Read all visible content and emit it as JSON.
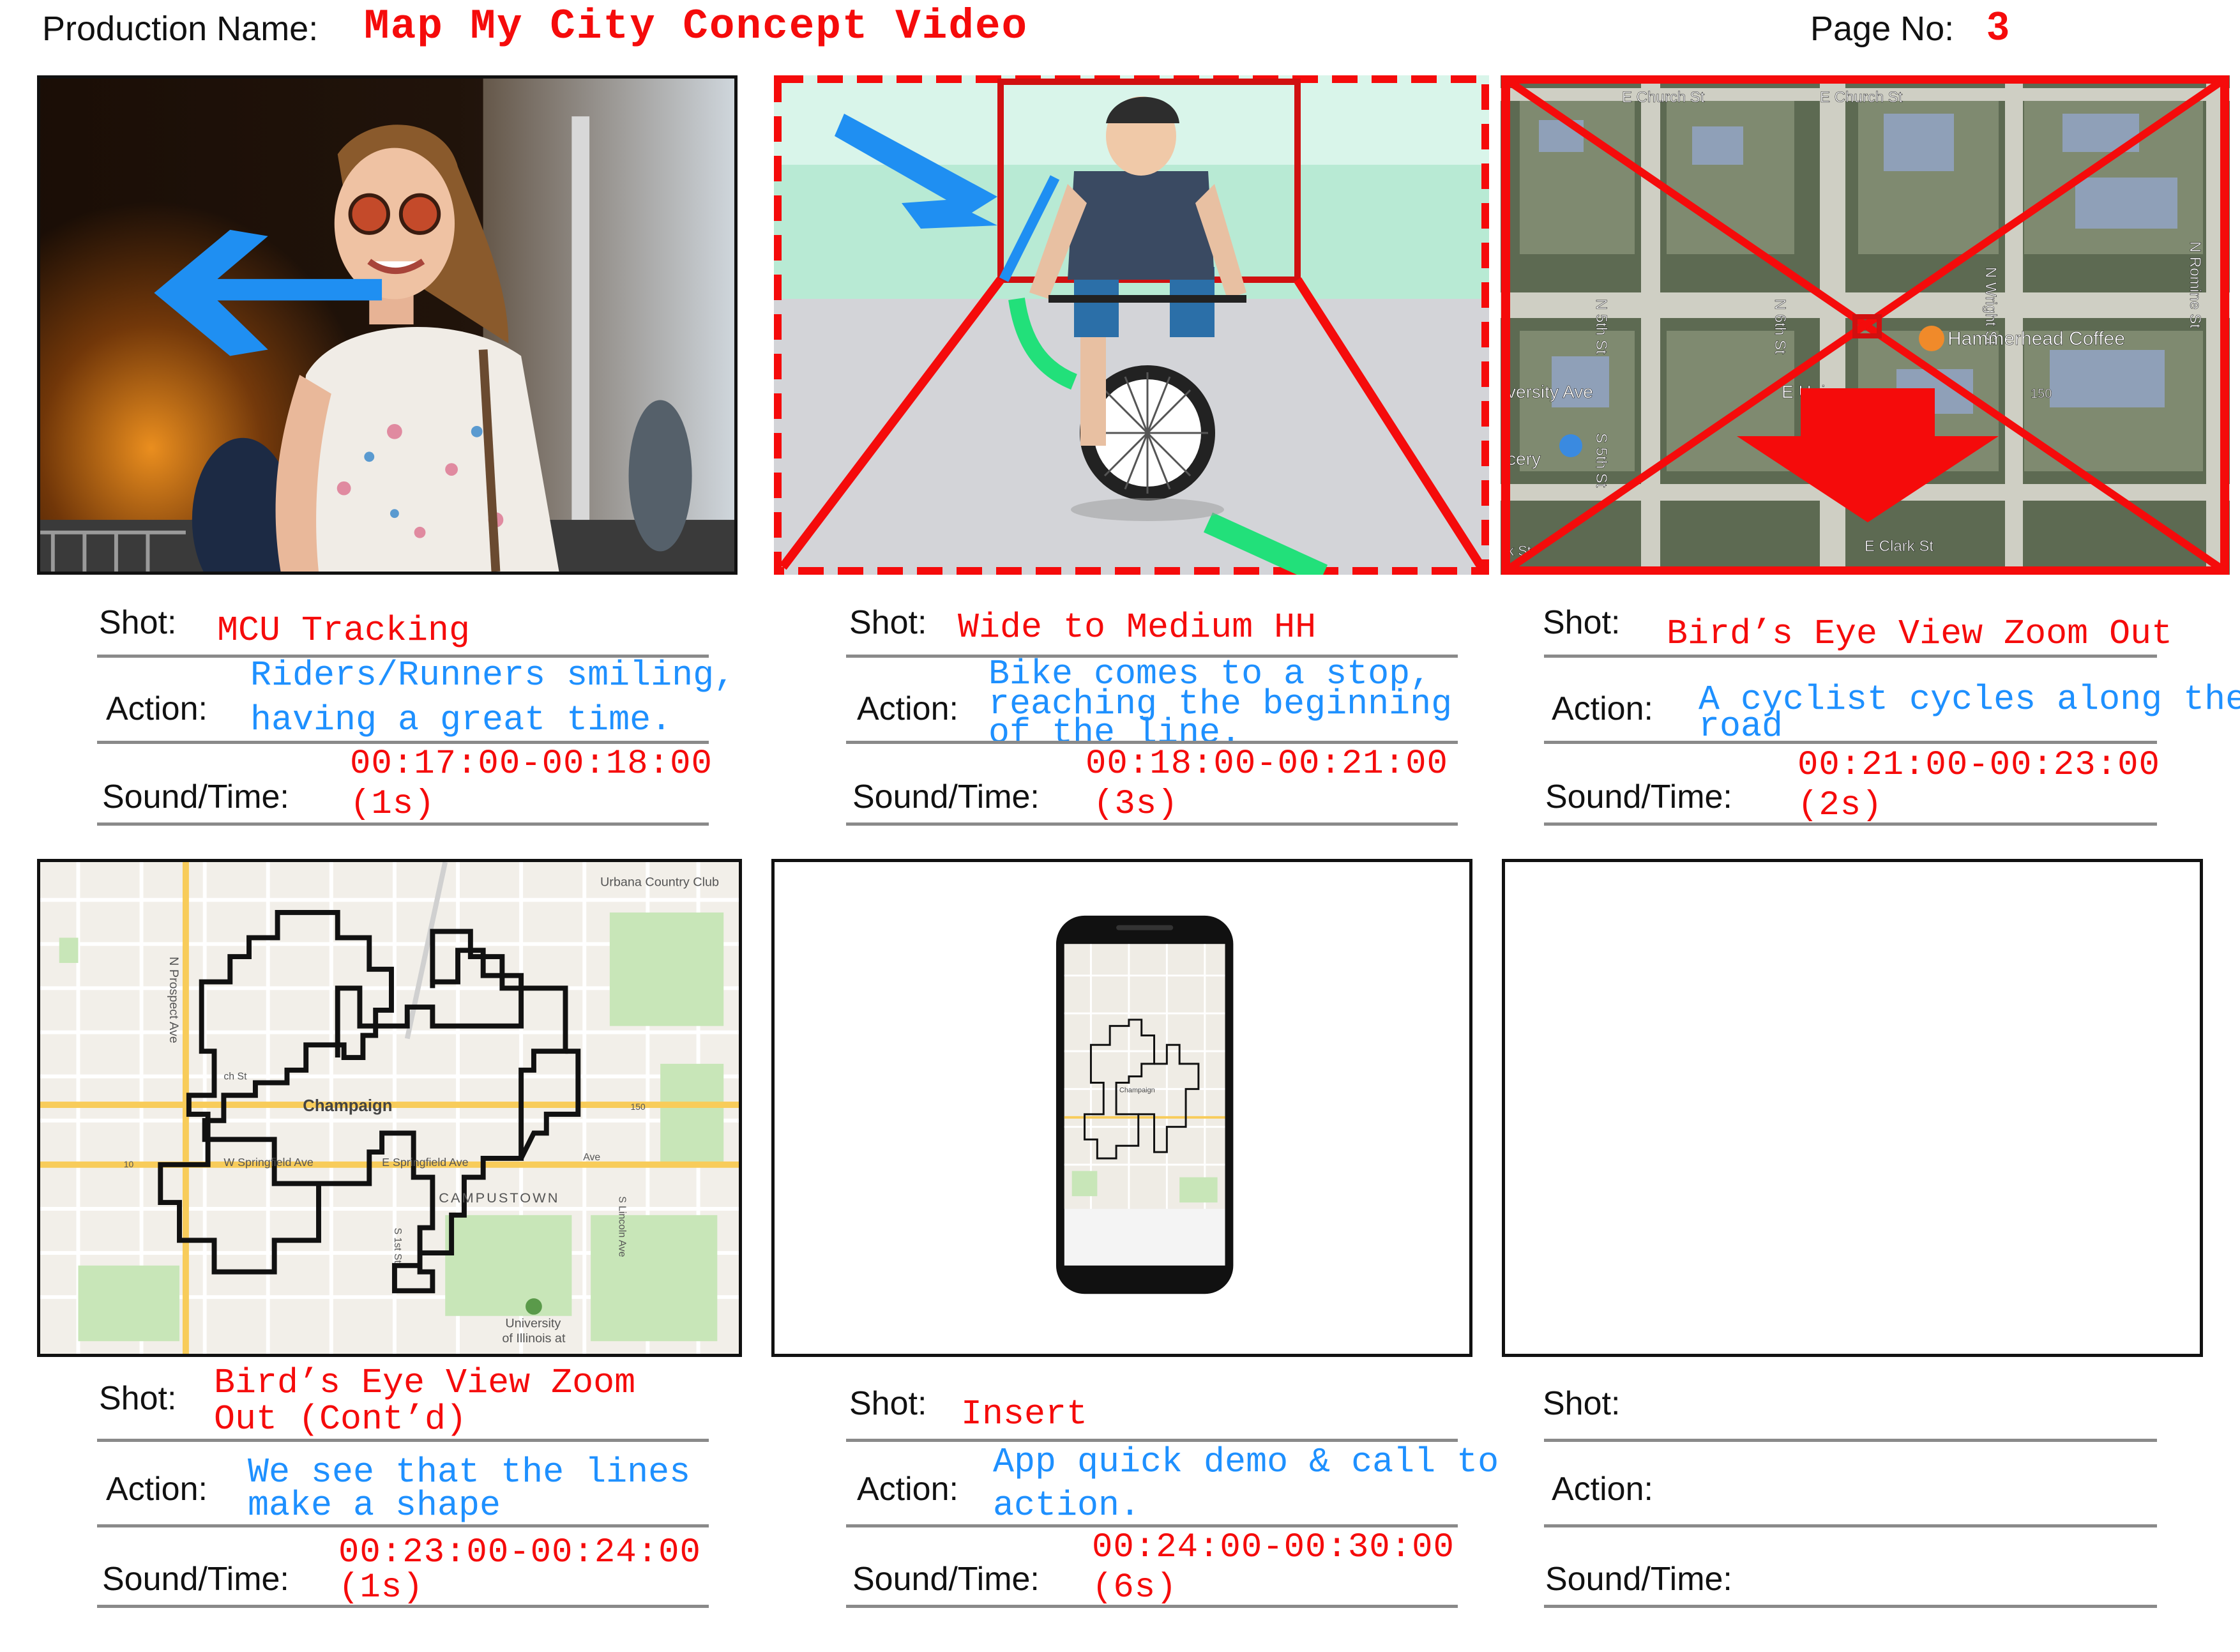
{
  "header": {
    "production_label": "Production Name:",
    "production_name": "Map My City Concept Video",
    "page_label": "Page No:",
    "page_number": "3"
  },
  "labels": {
    "shot": "Shot:",
    "action": "Action:",
    "sound_time": "Sound/Time:"
  },
  "panels": [
    {
      "shot": "MCU Tracking",
      "action_l1": "Riders/Runners smiling,",
      "action_l2": "having a great time.",
      "time": "00:17:00-00:18:00",
      "duration": "(1s)"
    },
    {
      "shot": "Wide to Medium HH",
      "action_l1": "Bike comes to a stop,",
      "action_l2": "reaching the beginning",
      "action_l3": "of the line.",
      "time": "00:18:00-00:21:00",
      "duration": "(3s)"
    },
    {
      "shot": "Bird’s Eye View Zoom Out",
      "action_l1": "A cyclist cycles along the",
      "action_l2": "road",
      "time": "00:21:00-00:23:00",
      "duration": "(2s)",
      "map_labels": [
        "E Church St",
        "E Church St",
        "N 5th St",
        "N 6th St",
        "N Wright St",
        "N Romine St",
        "Hammerhead Coffee",
        "versity Ave",
        "E Uni",
        "S 5th St",
        "cery",
        "E Clark St",
        "150",
        "k St"
      ]
    },
    {
      "shot_l1": "Bird’s Eye View Zoom",
      "shot_l2": "Out (Cont’d)",
      "action_l1": "We see that the lines",
      "action_l2": "make a shape",
      "time": "00:23:00-00:24:00",
      "duration": "(1s)",
      "map_labels": [
        "Urbana Country Club",
        "N Prospect Ave",
        "Champaign",
        "W Springfield Ave",
        "E Springfield Ave",
        "CAMPUSTOWN",
        "S 1st St",
        "S Lincoln Ave",
        "University",
        "of Illinois at",
        "150",
        "10",
        "Ave",
        "ch St"
      ]
    },
    {
      "shot": "Insert",
      "action_l1": "App quick demo & call to",
      "action_l2": "action.",
      "time": "00:24:00-00:30:00",
      "duration": "(6s)",
      "phone_map_label": "Champaign"
    },
    {
      "shot": "",
      "action_l1": "",
      "time": "",
      "duration": ""
    }
  ],
  "colors": {
    "accent_red": "#f50b0b",
    "note_blue": "#1e90ff",
    "arrow_blue": "#1f8ff2"
  }
}
